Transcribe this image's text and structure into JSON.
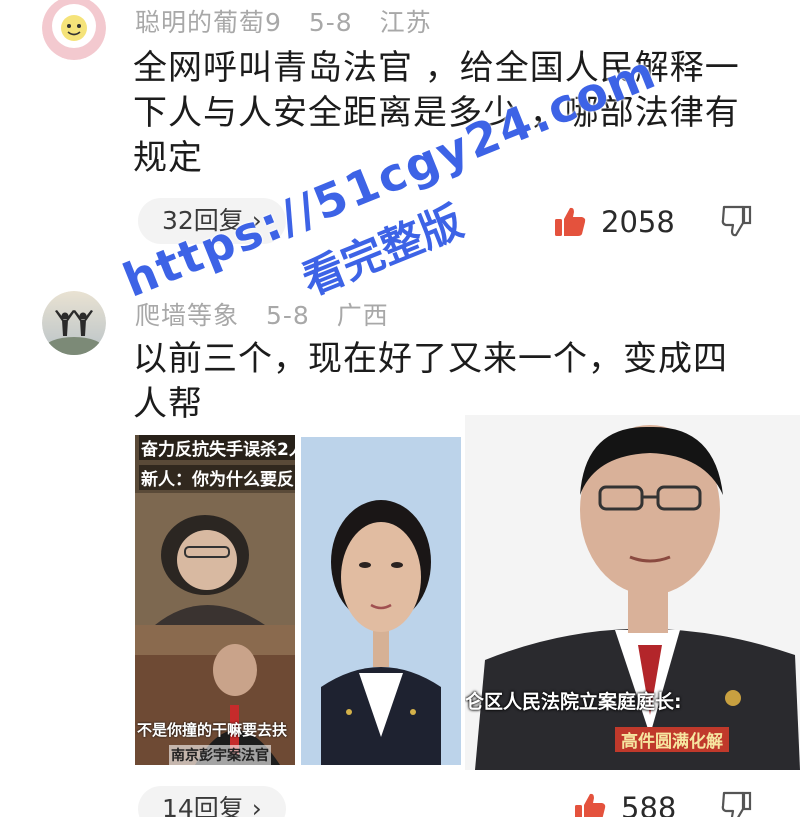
{
  "comments": [
    {
      "username": "聪明的葡萄9",
      "date": "5-8",
      "location": "江苏",
      "text_lines": [
        "全网呼叫青岛法官 ，给全国人民解释一",
        "下人与人安全距离是多少 ，哪部法律有",
        "规定"
      ],
      "replies_label": "32回复 ›",
      "likes": "2058"
    },
    {
      "username": "爬墙等象",
      "date": "5-8",
      "location": "广西",
      "text_lines": [
        "以前三个，现在好了又来一个，变成四",
        "人帮"
      ],
      "replies_label": "14回复 ›",
      "likes": "588"
    }
  ],
  "attached_image": {
    "panel1_caption_top": "奋力反抗失手误杀2人",
    "panel1_caption_sub": "新人：你为什么要反",
    "panel1_caption_bottom": "不是你撞的干嘛要去扶",
    "panel1_caption_bottom2": "南京彭宇案法官",
    "panel3_caption": "仑区人民法院立案庭庭长:",
    "panel3_caption_sub": "高件圆满化解"
  },
  "watermark": {
    "url": "https://51cgy24.com",
    "text": "看完整版"
  },
  "colors": {
    "like_icon": "#e4523d",
    "meta_text": "#a8a8a8",
    "watermark": "#3d63e6"
  }
}
